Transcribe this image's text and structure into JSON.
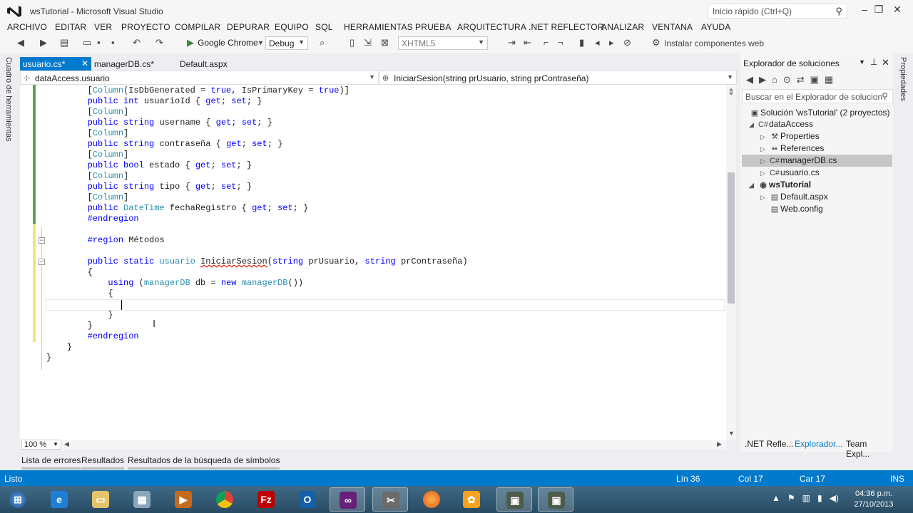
{
  "window": {
    "title": "wsTutorial - Microsoft Visual Studio",
    "quick_launch": "Inicio rápido (Ctrl+Q)"
  },
  "menu": [
    "ARCHIVO",
    "EDITAR",
    "VER",
    "PROYECTO",
    "COMPILAR",
    "DEPURAR",
    "EQUIPO",
    "SQL",
    "HERRAMIENTAS",
    "PRUEBA",
    "ARQUITECTURA",
    ".NET REFLECTOR",
    "ANALIZAR",
    "VENTANA",
    "AYUDA"
  ],
  "toolbar": {
    "run_target": "Google Chrome",
    "config": "Debug",
    "schema": "XHTML5",
    "install": "Instalar componentes web"
  },
  "left_tab": "Cuadro de herramientas",
  "right_tab": "Propiedades",
  "doc_tabs": [
    "usuario.cs*",
    "managerDB.cs*",
    "Default.aspx"
  ],
  "nav": {
    "type": "dataAccess.usuario",
    "member": "IniciarSesion(string prUsuario, string prContraseña)"
  },
  "code": [
    "        [Column(IsDbGenerated = true, IsPrimaryKey = true)]",
    "        public int usuarioId { get; set; }",
    "        [Column]",
    "        public string username { get; set; }",
    "        [Column]",
    "        public string contraseña { get; set; }",
    "        [Column]",
    "        public bool estado { get; set; }",
    "        [Column]",
    "        public string tipo { get; set; }",
    "        [Column]",
    "        public DateTime fechaRegistro { get; set; }",
    "        #endregion",
    "",
    "        #region Métodos",
    "",
    "        public static usuario IniciarSesion(string prUsuario, string prContraseña)",
    "        {",
    "            using (managerDB db = new managerDB())",
    "            {",
    "",
    "            }",
    "        }",
    "        #endregion",
    "    }",
    "}"
  ],
  "zoom": "100 %",
  "bottom_tabs": [
    "Lista de errores",
    "Resultados",
    "Resultados de la búsqueda de símbolos"
  ],
  "solution_explorer": {
    "title": "Explorador de soluciones",
    "search_placeholder": "Buscar en el Explorador de solucion",
    "items": [
      {
        "label": "Solución 'wsTutorial'  (2 proyectos)",
        "icon": "solution-icon"
      },
      {
        "label": "dataAccess",
        "icon": "csharp-project-icon"
      },
      {
        "label": "Properties",
        "icon": "wrench-icon"
      },
      {
        "label": "References",
        "icon": "references-icon"
      },
      {
        "label": "managerDB.cs",
        "icon": "csharp-file-icon"
      },
      {
        "label": "usuario.cs",
        "icon": "csharp-file-icon"
      },
      {
        "label": "wsTutorial",
        "icon": "globe-icon"
      },
      {
        "label": "Default.aspx",
        "icon": "aspx-file-icon"
      },
      {
        "label": "Web.config",
        "icon": "config-file-icon"
      }
    ],
    "tabs": [
      ".NET Refle...",
      "Explorador...",
      "Team Expl..."
    ]
  },
  "status": {
    "state": "Listo",
    "line": "Lín 36",
    "col": "Col 17",
    "car": "Car 17",
    "mode": "INS"
  },
  "clock": {
    "time": "04:36 p.m.",
    "date": "27/10/2013"
  },
  "colors": {
    "accent": "#007acc",
    "keyword": "#0000ff",
    "type": "#2b91af"
  }
}
